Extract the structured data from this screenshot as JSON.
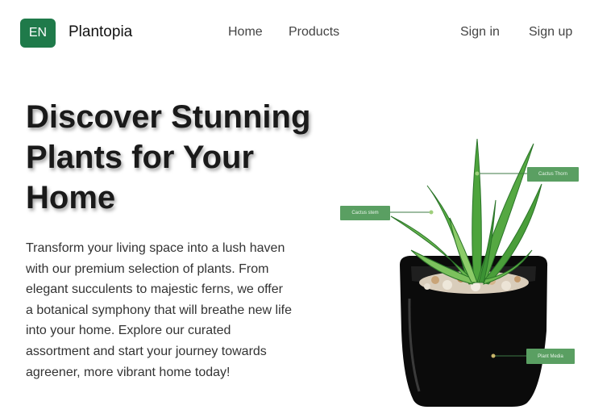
{
  "header": {
    "language_badge": "EN",
    "brand": "Plantopia",
    "nav": [
      "Home",
      "Products"
    ],
    "auth": {
      "sign_in": "Sign in",
      "sign_up": "Sign up"
    }
  },
  "hero": {
    "title": "Discover Stunning Plants for Your Home",
    "description": "Transform your living space into a lush haven with our premium selection of plants. From elegant succulents to majestic ferns, we offer a botanical symphony that will breathe new life into your home. Explore our curated assortment and start your journey towards agreener, more vibrant home today!"
  },
  "plant_labels": {
    "stem": "Cactus stem",
    "thorn": "Cactus Thorn",
    "media": "Plant Media"
  },
  "colors": {
    "brand_green": "#1f7a4a",
    "tag_green": "#5a9f62"
  }
}
